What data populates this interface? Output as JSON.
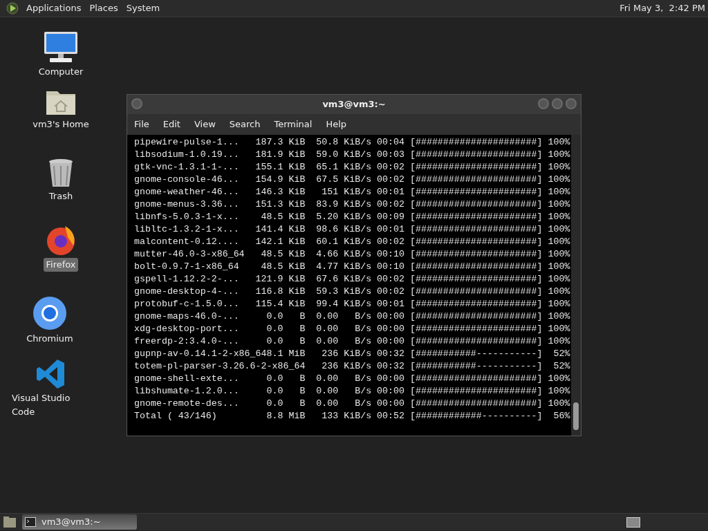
{
  "top_panel": {
    "menus": [
      "Applications",
      "Places",
      "System"
    ],
    "clock": "Fri May 3,  2:42 PM"
  },
  "desktop_icons": [
    {
      "kind": "computer",
      "label": "Computer",
      "selected": false
    },
    {
      "kind": "home",
      "label": "vm3's Home",
      "selected": false
    },
    {
      "kind": "trash",
      "label": "Trash",
      "selected": false
    },
    {
      "kind": "firefox",
      "label": "Firefox",
      "selected": true
    },
    {
      "kind": "chromium",
      "label": "Chromium",
      "selected": false
    },
    {
      "kind": "vscode",
      "label": "Visual Studio Code",
      "selected": false
    }
  ],
  "terminal": {
    "title": "vm3@vm3:~",
    "menu": [
      "File",
      "Edit",
      "View",
      "Search",
      "Terminal",
      "Help"
    ],
    "lines": [
      "pipewire-pulse-1...   187.3 KiB  50.8 KiB/s 00:04 [######################] 100%",
      "libsodium-1.0.19...   181.9 KiB  59.0 KiB/s 00:03 [######################] 100%",
      "gtk-vnc-1.3.1-1-...   155.1 KiB  65.1 KiB/s 00:02 [######################] 100%",
      "gnome-console-46...   154.9 KiB  67.5 KiB/s 00:02 [######################] 100%",
      "gnome-weather-46...   146.3 KiB   151 KiB/s 00:01 [######################] 100%",
      "gnome-menus-3.36...   151.3 KiB  83.9 KiB/s 00:02 [######################] 100%",
      "libnfs-5.0.3-1-x...    48.5 KiB  5.20 KiB/s 00:09 [######################] 100%",
      "libltc-1.3.2-1-x...   141.4 KiB  98.6 KiB/s 00:01 [######################] 100%",
      "malcontent-0.12....   142.1 KiB  60.1 KiB/s 00:02 [######################] 100%",
      "mutter-46.0-3-x86_64   48.5 KiB  4.66 KiB/s 00:10 [######################] 100%",
      "bolt-0.9.7-1-x86_64    48.5 KiB  4.77 KiB/s 00:10 [######################] 100%",
      "gspell-1.12.2-2-...   121.9 KiB  67.6 KiB/s 00:02 [######################] 100%",
      "gnome-desktop-4-...   116.8 KiB  59.3 KiB/s 00:02 [######################] 100%",
      "protobuf-c-1.5.0...   115.4 KiB  99.4 KiB/s 00:01 [######################] 100%",
      "gnome-maps-46.0-...     0.0   B  0.00   B/s 00:00 [######################] 100%",
      "xdg-desktop-port...     0.0   B  0.00   B/s 00:00 [######################] 100%",
      "freerdp-2:3.4.0-...     0.0   B  0.00   B/s 00:00 [######################] 100%",
      "gupnp-av-0.14.1-2-x86_648.1 MiB   236 KiB/s 00:32 [###########-----------]  52%",
      "totem-pl-parser-3.26.6-2-x86_64   236 KiB/s 00:32 [###########-----------]  52%",
      "gnome-shell-exte...     0.0   B  0.00   B/s 00:00 [######################] 100%",
      "libshumate-1.2.0...     0.0   B  0.00   B/s 00:00 [######################] 100%",
      "gnome-remote-des...     0.0   B  0.00   B/s 00:00 [######################] 100%",
      "Total ( 43/146)         8.8 MiB   133 KiB/s 00:52 [############----------]  56%"
    ]
  },
  "taskbar": {
    "tasks": [
      {
        "label": "vm3@vm3:~",
        "selected": true
      }
    ]
  }
}
